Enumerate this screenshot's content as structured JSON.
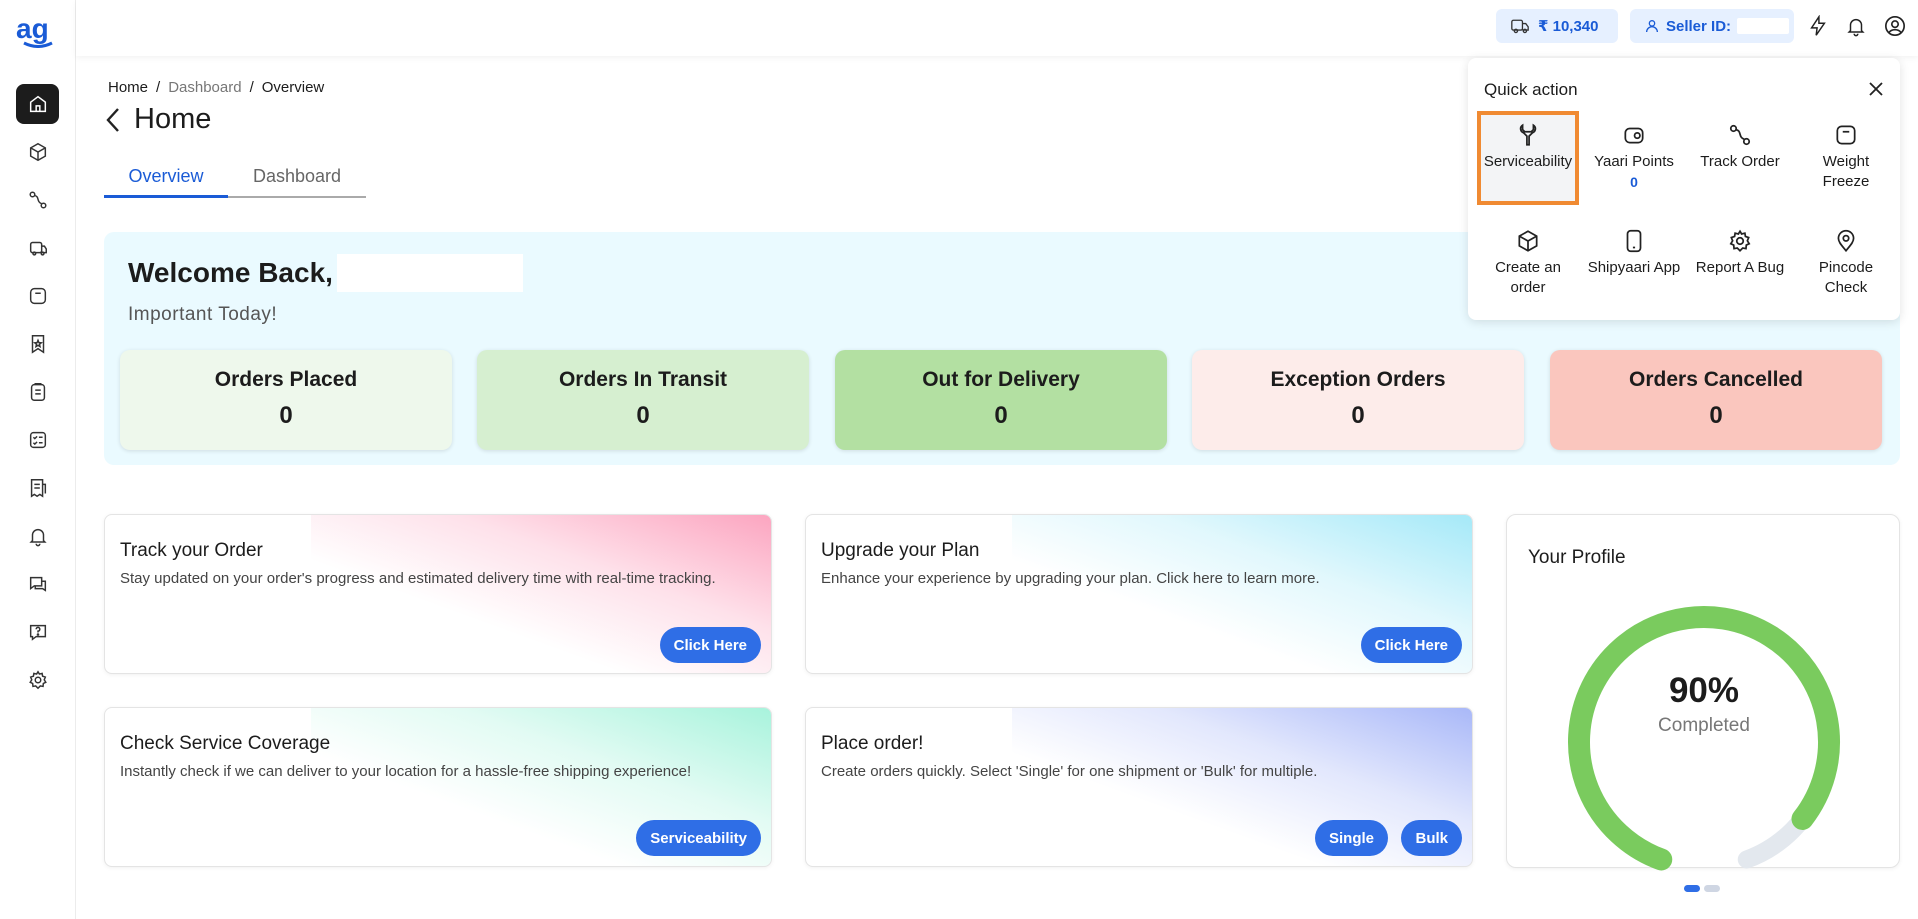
{
  "topbar": {
    "wallet_amount": "₹ 10,340",
    "seller_label": "Seller ID:"
  },
  "breadcrumb": [
    "Home",
    "/",
    "Dashboard",
    "/",
    "Overview"
  ],
  "page_title": "Home",
  "tabs": [
    {
      "label": "Overview",
      "active": true
    },
    {
      "label": "Dashboard",
      "active": false
    }
  ],
  "welcome": {
    "title": "Welcome Back,",
    "subtitle": "Important Today!"
  },
  "stats": [
    {
      "label": "Orders Placed",
      "value": "0",
      "color": "#eef8ec"
    },
    {
      "label": "Orders In Transit",
      "value": "0",
      "color": "#d6efd0"
    },
    {
      "label": "Out for Delivery",
      "value": "0",
      "color": "#b3e0a2"
    },
    {
      "label": "Exception Orders",
      "value": "0",
      "color": "#fdecea"
    },
    {
      "label": "Orders Cancelled",
      "value": "0",
      "color": "#fac6be"
    }
  ],
  "promos": [
    {
      "title": "Track your Order",
      "desc": "Stay updated on your order's progress and estimated delivery time with real-time tracking.",
      "buttons": [
        "Click Here"
      ],
      "accent": "#fca5c0"
    },
    {
      "title": "Upgrade your Plan",
      "desc": "Enhance your experience by upgrading your plan. Click here to learn more.",
      "buttons": [
        "Click Here"
      ],
      "accent": "#a5e9f8"
    },
    {
      "title": "Check Service Coverage",
      "desc": "Instantly check if we can deliver to your location for a hassle-free shipping experience!",
      "buttons": [
        "Serviceability"
      ],
      "accent": "#a8f3dc"
    },
    {
      "title": "Place order!",
      "desc": "Create orders quickly. Select 'Single' for one shipment or 'Bulk' for multiple.",
      "buttons": [
        "Single",
        "Bulk"
      ],
      "accent": "#a9b8f8"
    }
  ],
  "profile": {
    "title": "Your Profile",
    "percent_text": "90%",
    "percent_value": 90,
    "completed_label": "Completed",
    "ring_color": "#7acb5e"
  },
  "quick_action": {
    "title": "Quick action",
    "items": [
      {
        "label": "Serviceability",
        "icon": "wrench-icon"
      },
      {
        "label": "Yaari Points",
        "icon": "coins-icon",
        "extra": "0"
      },
      {
        "label": "Track Order",
        "icon": "route-icon"
      },
      {
        "label": "Weight Freeze",
        "icon": "weight-icon"
      },
      {
        "label": "Create an order",
        "icon": "box-icon"
      },
      {
        "label": "Shipyaari App",
        "icon": "phone-icon"
      },
      {
        "label": "Report A Bug",
        "icon": "gear-icon"
      },
      {
        "label": "Pincode Check",
        "icon": "location-pin-icon"
      }
    ]
  },
  "colors": {
    "accent": "#2f6ee6",
    "brand": "#1a5bd6",
    "highlight": "#f08a32"
  }
}
